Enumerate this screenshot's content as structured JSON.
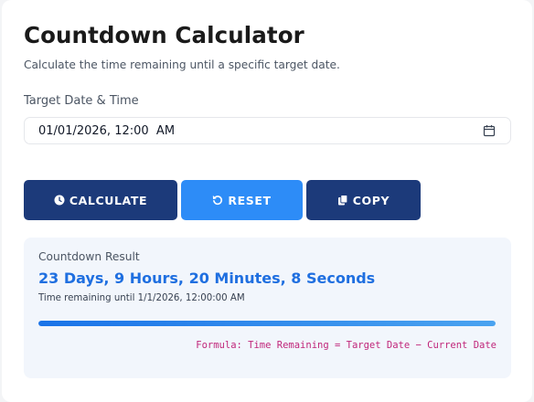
{
  "header": {
    "title": "Countdown Calculator",
    "subtitle": "Calculate the time remaining until a specific target date."
  },
  "target_field": {
    "label": "Target Date & Time",
    "value": "01/01/2026, 12:00  AM",
    "icon": "calendar-icon"
  },
  "buttons": {
    "calculate": {
      "label": "CALCULATE",
      "icon": "clock-icon",
      "color": "#1c3a7a"
    },
    "reset": {
      "label": "RESET",
      "icon": "reset-icon",
      "color": "#2d8cf7"
    },
    "copy": {
      "label": "COPY",
      "icon": "copy-icon",
      "color": "#1c3a7a"
    }
  },
  "result": {
    "label": "Countdown Result",
    "value": "23 Days, 9 Hours, 20 Minutes, 8 Seconds",
    "note": "Time remaining until 1/1/2026, 12:00:00 AM",
    "progress": 1.0,
    "formula": "Formula: Time Remaining = Target Date − Current Date"
  },
  "colors": {
    "accent": "#1f6fe0",
    "formula": "#c0267a",
    "dark_button": "#1c3a7a",
    "light_button": "#2d8cf7"
  }
}
